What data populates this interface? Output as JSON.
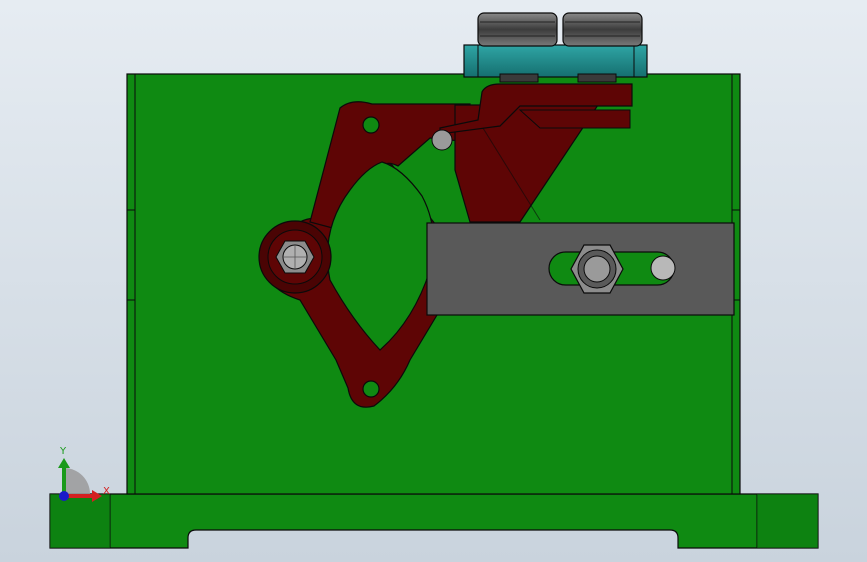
{
  "viewport": {
    "background": [
      "#e6ecf2",
      "#c9d3dd"
    ]
  },
  "model": {
    "colors": {
      "body_green": "#0f8a12",
      "edge": "#0a0a0a",
      "link_red": "#5e0505",
      "plate_gray": "#595959",
      "clamp_teal": "#1e8a8a",
      "screw_gray": "#4d4d4d",
      "base_green": "#0f8a12"
    }
  },
  "triad": {
    "x_label": "X",
    "y_label": "Y",
    "x_color": "#d42020",
    "y_color": "#1a9a1a",
    "z_color": "#1a1ac8"
  }
}
